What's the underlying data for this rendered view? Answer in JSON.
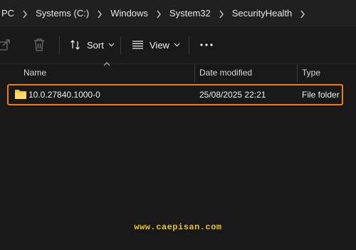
{
  "breadcrumb": [
    "PC",
    "Systems (C:)",
    "Windows",
    "System32",
    "SecurityHealth"
  ],
  "toolbar": {
    "share_icon": "share-icon",
    "delete_icon": "trash-icon",
    "sort_label": "Sort",
    "view_label": "View",
    "more_icon": "ellipsis-icon"
  },
  "columns": {
    "name": "Name",
    "date_modified": "Date modified",
    "type": "Type"
  },
  "rows": [
    {
      "name": "10.0.27840.1000-0",
      "date_modified": "25/08/2025 22:21",
      "type": "File folder"
    }
  ],
  "watermark": "www.caepisan.com",
  "colors": {
    "background": "#191919",
    "address_bar": "#202020",
    "selection_outline": "#f07b1a",
    "folder": "#f5c542",
    "watermark": "#e6c422"
  }
}
